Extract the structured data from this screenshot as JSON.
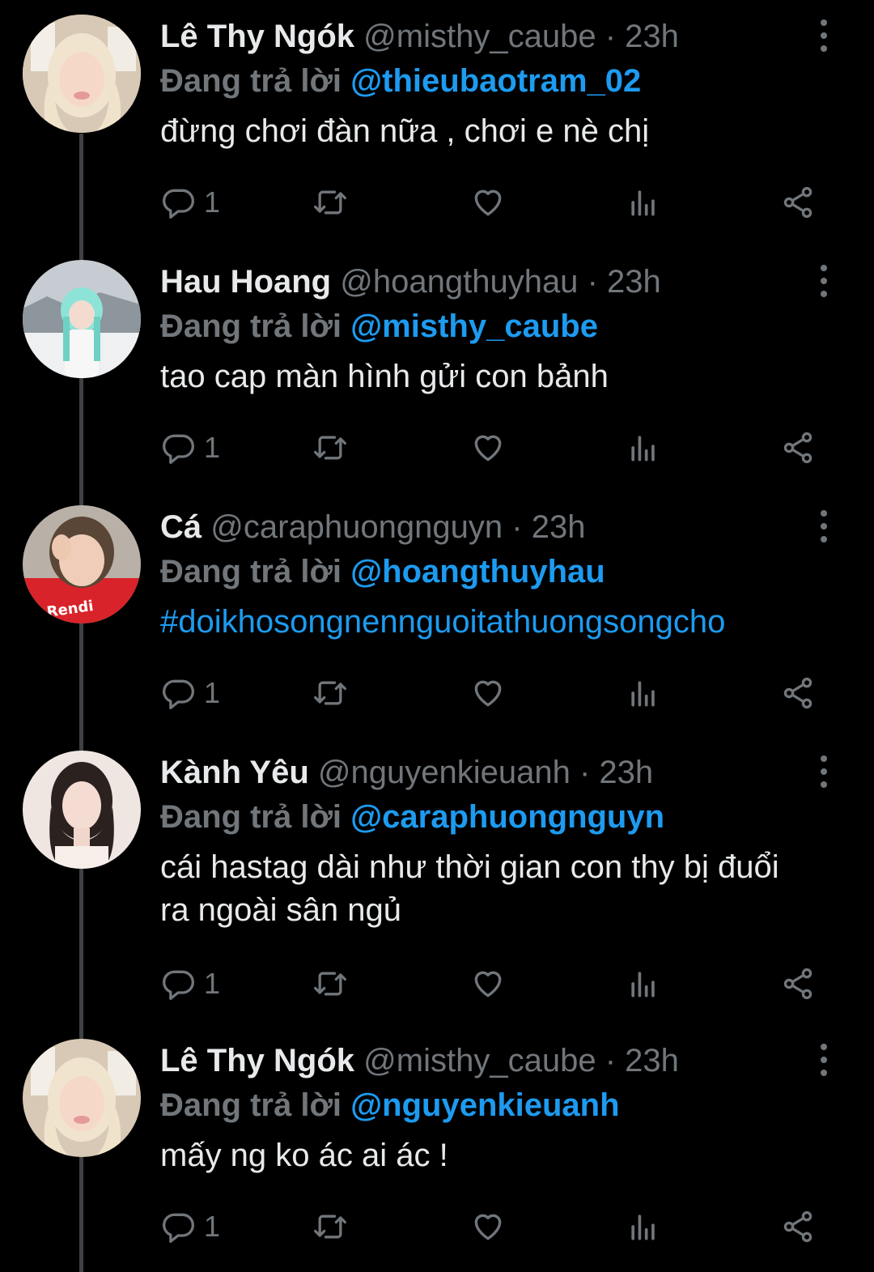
{
  "tweets": [
    {
      "name": "Lê Thy Ngók",
      "handle": "@misthy_caube",
      "dot": "·",
      "time": "23h",
      "reply_prefix": "Đang trả lời",
      "reply_to": "@thieubaotram_02",
      "text": "đừng chơi đàn nữa , chơi e nè chị",
      "reply_count": "1"
    },
    {
      "name": "Hau Hoang",
      "handle": "@hoangthuyhau",
      "dot": "·",
      "time": "23h",
      "reply_prefix": "Đang trả lời",
      "reply_to": "@misthy_caube",
      "text": "tao cap màn hình gửi con bảnh",
      "reply_count": "1"
    },
    {
      "name": "Cá",
      "handle": "@caraphuongnguyn",
      "dot": "·",
      "time": "23h",
      "reply_prefix": "Đang trả lời",
      "reply_to": "@hoangthuyhau",
      "text": "#doikhosongnennguoitathuongsongcho",
      "reply_count": "1"
    },
    {
      "name": "Kành Yêu",
      "handle": "@nguyenkieuanh",
      "dot": "·",
      "time": "23h",
      "reply_prefix": "Đang trả lời",
      "reply_to": "@caraphuongnguyn",
      "text": "cái hastag dài như thời gian con thy bị đuổi ra ngoài sân ngủ",
      "reply_count": "1"
    },
    {
      "name": "Lê Thy Ngók",
      "handle": "@misthy_caube",
      "dot": "·",
      "time": "23h",
      "reply_prefix": "Đang trả lời",
      "reply_to": "@nguyenkieuanh",
      "text": "mấy ng ko ác ai ác !",
      "reply_count": "1"
    }
  ],
  "colors": {
    "background": "#000000",
    "primary_text": "#e7e9ea",
    "secondary_text": "#71767b",
    "accent": "#1d9bf0",
    "thread_line": "#3e4144"
  },
  "icons": [
    "reply-icon",
    "retweet-icon",
    "like-icon",
    "analytics-icon",
    "share-icon",
    "more-icon"
  ]
}
